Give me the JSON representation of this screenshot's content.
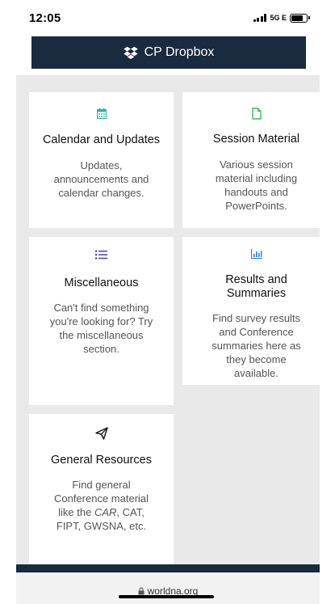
{
  "status_bar": {
    "time": "12:05",
    "network": "5G E"
  },
  "header": {
    "dropbox_label": "CP Dropbox",
    "dropbox_icon": "dropbox-icon"
  },
  "colors": {
    "navy": "#1a2a3f",
    "icon_teal": "#26b5a8",
    "icon_green": "#3bbf4b",
    "icon_purple": "#4a3fc7",
    "icon_blue": "#2a7dd6"
  },
  "cards": {
    "calendar": {
      "icon": "calendar-icon",
      "title": "Calendar and Updates",
      "desc": [
        "Updates,",
        "announcements and",
        "calendar changes."
      ]
    },
    "session": {
      "icon": "document-icon",
      "title": "Session Material",
      "desc": [
        "Various session",
        "material including",
        "handouts and",
        "PowerPoints."
      ]
    },
    "misc": {
      "icon": "list-icon",
      "title": "Miscellaneous",
      "desc": [
        "Can't find something",
        "you're looking for? Try",
        "the miscellaneous",
        "section."
      ]
    },
    "results": {
      "icon": "bar-chart-icon",
      "title": [
        "Results and",
        "Summaries"
      ],
      "desc": [
        "Find survey results",
        "and Conference",
        "summaries here as",
        "they become",
        "available."
      ]
    },
    "general": {
      "icon": "paper-plane-icon",
      "title": "General Resources",
      "desc": [
        "Find general",
        "Conference material",
        "like the CAR, CAT,",
        "FIPT, GWSNA, etc."
      ]
    }
  },
  "browser": {
    "url": "worldna.org"
  }
}
